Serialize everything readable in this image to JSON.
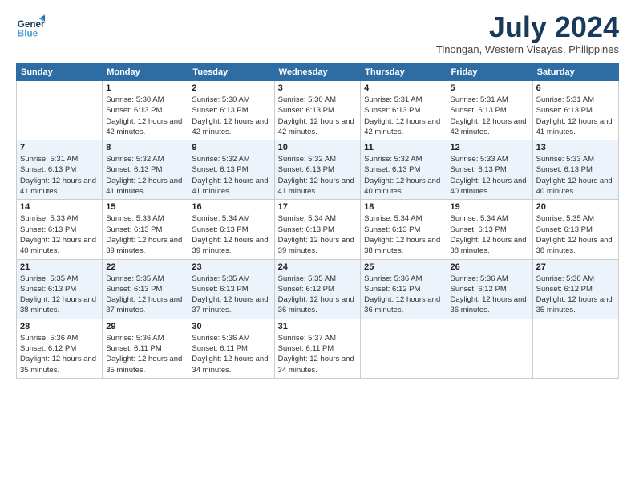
{
  "logo": {
    "line1": "General",
    "line2": "Blue"
  },
  "header": {
    "month_year": "July 2024",
    "location": "Tinongan, Western Visayas, Philippines"
  },
  "weekdays": [
    "Sunday",
    "Monday",
    "Tuesday",
    "Wednesday",
    "Thursday",
    "Friday",
    "Saturday"
  ],
  "weeks": [
    [
      {
        "day": "",
        "sunrise": "",
        "sunset": "",
        "daylight": ""
      },
      {
        "day": "1",
        "sunrise": "Sunrise: 5:30 AM",
        "sunset": "Sunset: 6:13 PM",
        "daylight": "Daylight: 12 hours and 42 minutes."
      },
      {
        "day": "2",
        "sunrise": "Sunrise: 5:30 AM",
        "sunset": "Sunset: 6:13 PM",
        "daylight": "Daylight: 12 hours and 42 minutes."
      },
      {
        "day": "3",
        "sunrise": "Sunrise: 5:30 AM",
        "sunset": "Sunset: 6:13 PM",
        "daylight": "Daylight: 12 hours and 42 minutes."
      },
      {
        "day": "4",
        "sunrise": "Sunrise: 5:31 AM",
        "sunset": "Sunset: 6:13 PM",
        "daylight": "Daylight: 12 hours and 42 minutes."
      },
      {
        "day": "5",
        "sunrise": "Sunrise: 5:31 AM",
        "sunset": "Sunset: 6:13 PM",
        "daylight": "Daylight: 12 hours and 42 minutes."
      },
      {
        "day": "6",
        "sunrise": "Sunrise: 5:31 AM",
        "sunset": "Sunset: 6:13 PM",
        "daylight": "Daylight: 12 hours and 41 minutes."
      }
    ],
    [
      {
        "day": "7",
        "sunrise": "Sunrise: 5:31 AM",
        "sunset": "Sunset: 6:13 PM",
        "daylight": "Daylight: 12 hours and 41 minutes."
      },
      {
        "day": "8",
        "sunrise": "Sunrise: 5:32 AM",
        "sunset": "Sunset: 6:13 PM",
        "daylight": "Daylight: 12 hours and 41 minutes."
      },
      {
        "day": "9",
        "sunrise": "Sunrise: 5:32 AM",
        "sunset": "Sunset: 6:13 PM",
        "daylight": "Daylight: 12 hours and 41 minutes."
      },
      {
        "day": "10",
        "sunrise": "Sunrise: 5:32 AM",
        "sunset": "Sunset: 6:13 PM",
        "daylight": "Daylight: 12 hours and 41 minutes."
      },
      {
        "day": "11",
        "sunrise": "Sunrise: 5:32 AM",
        "sunset": "Sunset: 6:13 PM",
        "daylight": "Daylight: 12 hours and 40 minutes."
      },
      {
        "day": "12",
        "sunrise": "Sunrise: 5:33 AM",
        "sunset": "Sunset: 6:13 PM",
        "daylight": "Daylight: 12 hours and 40 minutes."
      },
      {
        "day": "13",
        "sunrise": "Sunrise: 5:33 AM",
        "sunset": "Sunset: 6:13 PM",
        "daylight": "Daylight: 12 hours and 40 minutes."
      }
    ],
    [
      {
        "day": "14",
        "sunrise": "Sunrise: 5:33 AM",
        "sunset": "Sunset: 6:13 PM",
        "daylight": "Daylight: 12 hours and 40 minutes."
      },
      {
        "day": "15",
        "sunrise": "Sunrise: 5:33 AM",
        "sunset": "Sunset: 6:13 PM",
        "daylight": "Daylight: 12 hours and 39 minutes."
      },
      {
        "day": "16",
        "sunrise": "Sunrise: 5:34 AM",
        "sunset": "Sunset: 6:13 PM",
        "daylight": "Daylight: 12 hours and 39 minutes."
      },
      {
        "day": "17",
        "sunrise": "Sunrise: 5:34 AM",
        "sunset": "Sunset: 6:13 PM",
        "daylight": "Daylight: 12 hours and 39 minutes."
      },
      {
        "day": "18",
        "sunrise": "Sunrise: 5:34 AM",
        "sunset": "Sunset: 6:13 PM",
        "daylight": "Daylight: 12 hours and 38 minutes."
      },
      {
        "day": "19",
        "sunrise": "Sunrise: 5:34 AM",
        "sunset": "Sunset: 6:13 PM",
        "daylight": "Daylight: 12 hours and 38 minutes."
      },
      {
        "day": "20",
        "sunrise": "Sunrise: 5:35 AM",
        "sunset": "Sunset: 6:13 PM",
        "daylight": "Daylight: 12 hours and 38 minutes."
      }
    ],
    [
      {
        "day": "21",
        "sunrise": "Sunrise: 5:35 AM",
        "sunset": "Sunset: 6:13 PM",
        "daylight": "Daylight: 12 hours and 38 minutes."
      },
      {
        "day": "22",
        "sunrise": "Sunrise: 5:35 AM",
        "sunset": "Sunset: 6:13 PM",
        "daylight": "Daylight: 12 hours and 37 minutes."
      },
      {
        "day": "23",
        "sunrise": "Sunrise: 5:35 AM",
        "sunset": "Sunset: 6:13 PM",
        "daylight": "Daylight: 12 hours and 37 minutes."
      },
      {
        "day": "24",
        "sunrise": "Sunrise: 5:35 AM",
        "sunset": "Sunset: 6:12 PM",
        "daylight": "Daylight: 12 hours and 36 minutes."
      },
      {
        "day": "25",
        "sunrise": "Sunrise: 5:36 AM",
        "sunset": "Sunset: 6:12 PM",
        "daylight": "Daylight: 12 hours and 36 minutes."
      },
      {
        "day": "26",
        "sunrise": "Sunrise: 5:36 AM",
        "sunset": "Sunset: 6:12 PM",
        "daylight": "Daylight: 12 hours and 36 minutes."
      },
      {
        "day": "27",
        "sunrise": "Sunrise: 5:36 AM",
        "sunset": "Sunset: 6:12 PM",
        "daylight": "Daylight: 12 hours and 35 minutes."
      }
    ],
    [
      {
        "day": "28",
        "sunrise": "Sunrise: 5:36 AM",
        "sunset": "Sunset: 6:12 PM",
        "daylight": "Daylight: 12 hours and 35 minutes."
      },
      {
        "day": "29",
        "sunrise": "Sunrise: 5:36 AM",
        "sunset": "Sunset: 6:11 PM",
        "daylight": "Daylight: 12 hours and 35 minutes."
      },
      {
        "day": "30",
        "sunrise": "Sunrise: 5:36 AM",
        "sunset": "Sunset: 6:11 PM",
        "daylight": "Daylight: 12 hours and 34 minutes."
      },
      {
        "day": "31",
        "sunrise": "Sunrise: 5:37 AM",
        "sunset": "Sunset: 6:11 PM",
        "daylight": "Daylight: 12 hours and 34 minutes."
      },
      {
        "day": "",
        "sunrise": "",
        "sunset": "",
        "daylight": ""
      },
      {
        "day": "",
        "sunrise": "",
        "sunset": "",
        "daylight": ""
      },
      {
        "day": "",
        "sunrise": "",
        "sunset": "",
        "daylight": ""
      }
    ]
  ]
}
